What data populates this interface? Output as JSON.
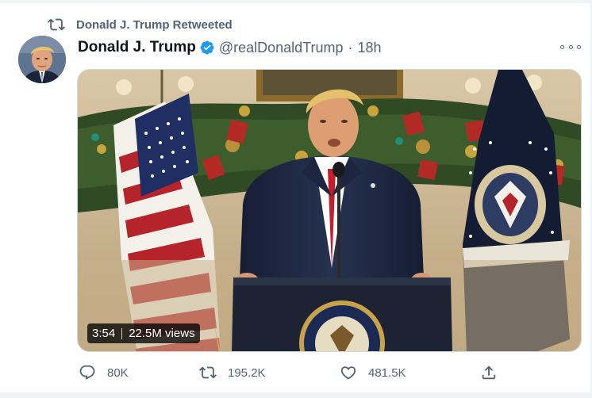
{
  "retweet": {
    "label": "Donald J. Trump Retweeted",
    "icon": "retweet-icon"
  },
  "author": {
    "display_name": "Donald J. Trump",
    "handle": "@realDonaldTrump",
    "separator": "·",
    "time": "18h",
    "verified": true,
    "verified_color": "#1d9bf0"
  },
  "media": {
    "type": "video",
    "duration": "3:54",
    "views": "22.5M views"
  },
  "actions": {
    "reply": {
      "count": "80K",
      "icon": "reply-icon"
    },
    "retweet": {
      "count": "195.2K",
      "icon": "retweet-icon"
    },
    "like": {
      "count": "481.5K",
      "icon": "heart-icon"
    },
    "share": {
      "icon": "share-icon"
    }
  },
  "colors": {
    "secondary_text": "#536471",
    "primary_text": "#0f1419",
    "border": "#eff3f4"
  }
}
